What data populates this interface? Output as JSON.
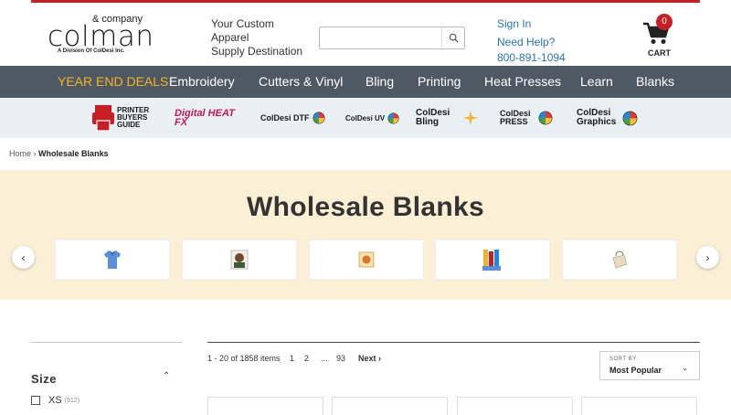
{
  "header": {
    "logo": {
      "company": "& company",
      "name": "colman",
      "division": "A Division Of ColDesi Inc."
    },
    "tagline": [
      "Your Custom",
      "Apparel",
      "Supply Destination"
    ],
    "search": {
      "placeholder": "",
      "value": ""
    },
    "signin": "Sign In",
    "help": "Need Help?",
    "phone": "800-891-1094",
    "cart": {
      "count": "0",
      "label": "CART"
    }
  },
  "nav": {
    "items": [
      "YEAR END DEALS",
      "Embroidery",
      "Cutters & Vinyl",
      "Bling",
      "Printing",
      "Heat Presses",
      "Learn",
      "Blanks"
    ]
  },
  "brands": {
    "items": [
      "PRINTER BUYERS GUIDE",
      "Digital HEAT FX",
      "ColDesi DTF",
      "ColDesi UV",
      "ColDesi Bling",
      "ColDesi PRESS",
      "ColDesi Graphics"
    ]
  },
  "breadcrumb": {
    "home": "Home",
    "sep": "›",
    "current": "Wholesale Blanks"
  },
  "hero": {
    "title": "Wholesale Blanks"
  },
  "filters": {
    "size_title": "Size",
    "options": [
      {
        "label": "XS",
        "count": "(912)"
      }
    ]
  },
  "results": {
    "summary": "1 - 20 of 1858 items",
    "pages": [
      "1",
      "2",
      "...",
      "93"
    ],
    "next": "Next ›"
  },
  "sort": {
    "caption": "SORT BY:",
    "value": "Most Popular"
  },
  "colors": {
    "accent_red": "#c62026",
    "nav_bg": "#4f5963",
    "deals": "#f4b324",
    "link": "#2a73b8",
    "hero_bg": "#fbefd6",
    "brand_bg": "#e9eff3"
  }
}
